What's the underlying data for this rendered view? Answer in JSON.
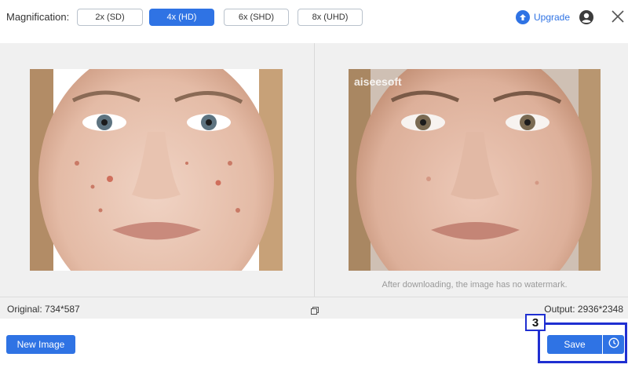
{
  "toolbar": {
    "magnification_label": "Magnification:",
    "options": [
      {
        "label": "2x (SD)",
        "active": false
      },
      {
        "label": "4x (HD)",
        "active": true
      },
      {
        "label": "6x (SHD)",
        "active": false
      },
      {
        "label": "8x (UHD)",
        "active": false
      }
    ],
    "upgrade_label": "Upgrade",
    "icons": [
      "upload-arrow-icon",
      "account-icon",
      "close-icon"
    ]
  },
  "preview": {
    "watermark": "aiseesoft",
    "note": "After downloading, the image has no watermark."
  },
  "info": {
    "original": "Original: 734*587",
    "output": "Output: 2936*2348"
  },
  "actions": {
    "new_image_label": "New Image",
    "save_label": "Save",
    "step_badge": "3"
  },
  "colors": {
    "accent": "#2f73e4",
    "highlight": "#1f2fd1"
  }
}
